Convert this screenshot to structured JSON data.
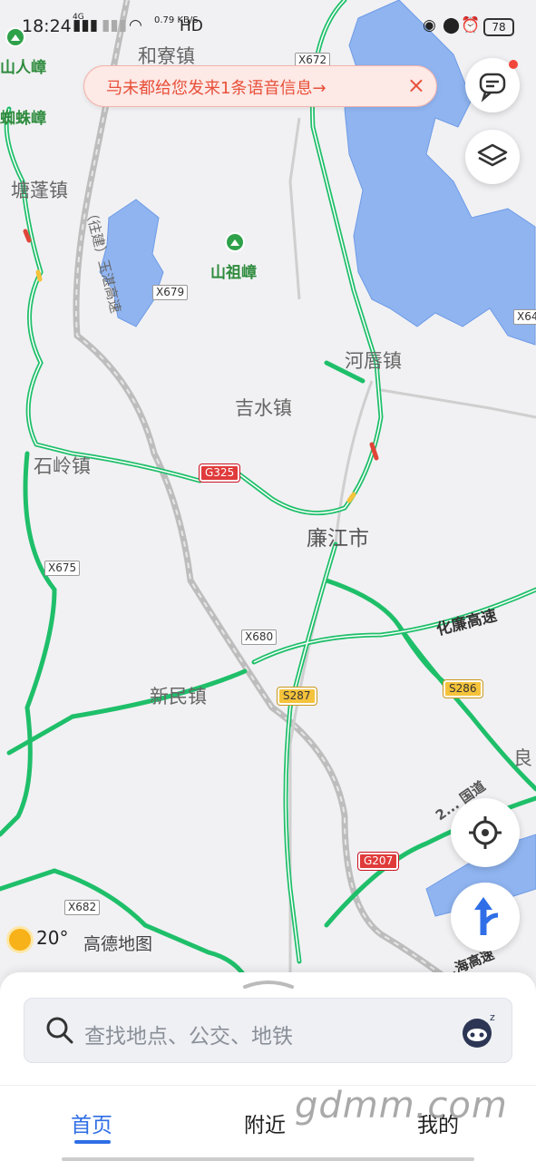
{
  "status_bar": {
    "time": "18:24",
    "network": "4G",
    "net_speed": "0.79 KB/S",
    "hd": "HD",
    "battery": "78"
  },
  "notice": {
    "text": "马未都给您发来1条语音信息→",
    "close": "×"
  },
  "map": {
    "places": {
      "hezhai": "和寮镇",
      "tangpeng": "塘蓬镇",
      "shanzu": "山祖嶂",
      "shanren": "山人嶂",
      "zhuzhang": "蜘蛛嶂",
      "heliu": "河唇镇",
      "jishui": "吉水镇",
      "shiling": "石岭镇",
      "lianjiang": "廉江市",
      "xinmin": "新民镇",
      "liang": "良"
    },
    "roads": {
      "x672": "X672",
      "x679": "X679",
      "x64": "X64",
      "g325": "G325",
      "x675": "X675",
      "x680": "X680",
      "s287": "S287",
      "s286": "S286",
      "g207": "G207",
      "x682": "X682",
      "hualian": "化廉高速",
      "yuzhan": "（往建）玉湛高速",
      "guodao": "2... 国道",
      "haigao": "...海高速"
    }
  },
  "weather": {
    "temp": "20°",
    "icon": "sun-icon"
  },
  "brand": "高德地图",
  "search": {
    "placeholder": "查找地点、公交、地铁"
  },
  "tabs": {
    "home": "首页",
    "nearby": "附近",
    "mine": "我的"
  },
  "watermark": "gdmm.com",
  "colors": {
    "accent": "#2f6ee6",
    "road_green": "#1fbf6a",
    "water": "#8fb4f0",
    "notice_text": "#e8503a"
  }
}
